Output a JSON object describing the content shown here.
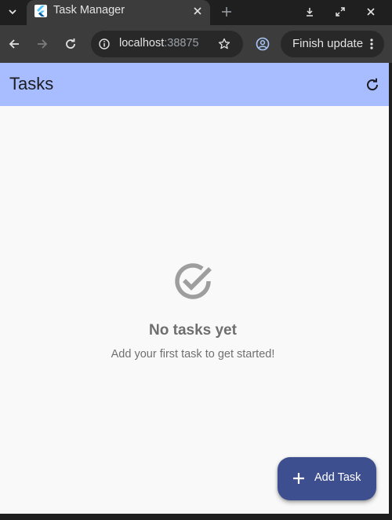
{
  "browser": {
    "tab": {
      "title": "Task Manager",
      "favicon": "flutter-logo-icon"
    },
    "address_bar": {
      "host": "localhost",
      "port": ":38875"
    },
    "update_button_label": "Finish update",
    "icons": {
      "tab_search": "chevron-down-icon",
      "close_tab": "close-icon",
      "new_tab": "plus-icon",
      "download": "download-icon",
      "maximize": "maximize-icon",
      "close_window": "close-icon",
      "back": "back-arrow-icon",
      "forward": "forward-arrow-icon",
      "reload": "reload-icon",
      "site_info": "info-icon",
      "bookmark": "star-icon",
      "profile": "profile-icon",
      "menu": "more-vert-icon"
    }
  },
  "app": {
    "title": "Tasks",
    "refresh_icon": "refresh-icon",
    "empty_state": {
      "icon": "check-circle-icon",
      "title": "No tasks yet",
      "subtitle": "Add your first task to get started!"
    },
    "fab": {
      "icon": "plus-icon",
      "label": "Add Task"
    }
  },
  "colors": {
    "app_bar": "#a8bdff",
    "background": "#f9f9f9",
    "fab": "#3d4f8f",
    "browser_frame": "#1f1f1f",
    "toolbar": "#3c3c3c"
  }
}
